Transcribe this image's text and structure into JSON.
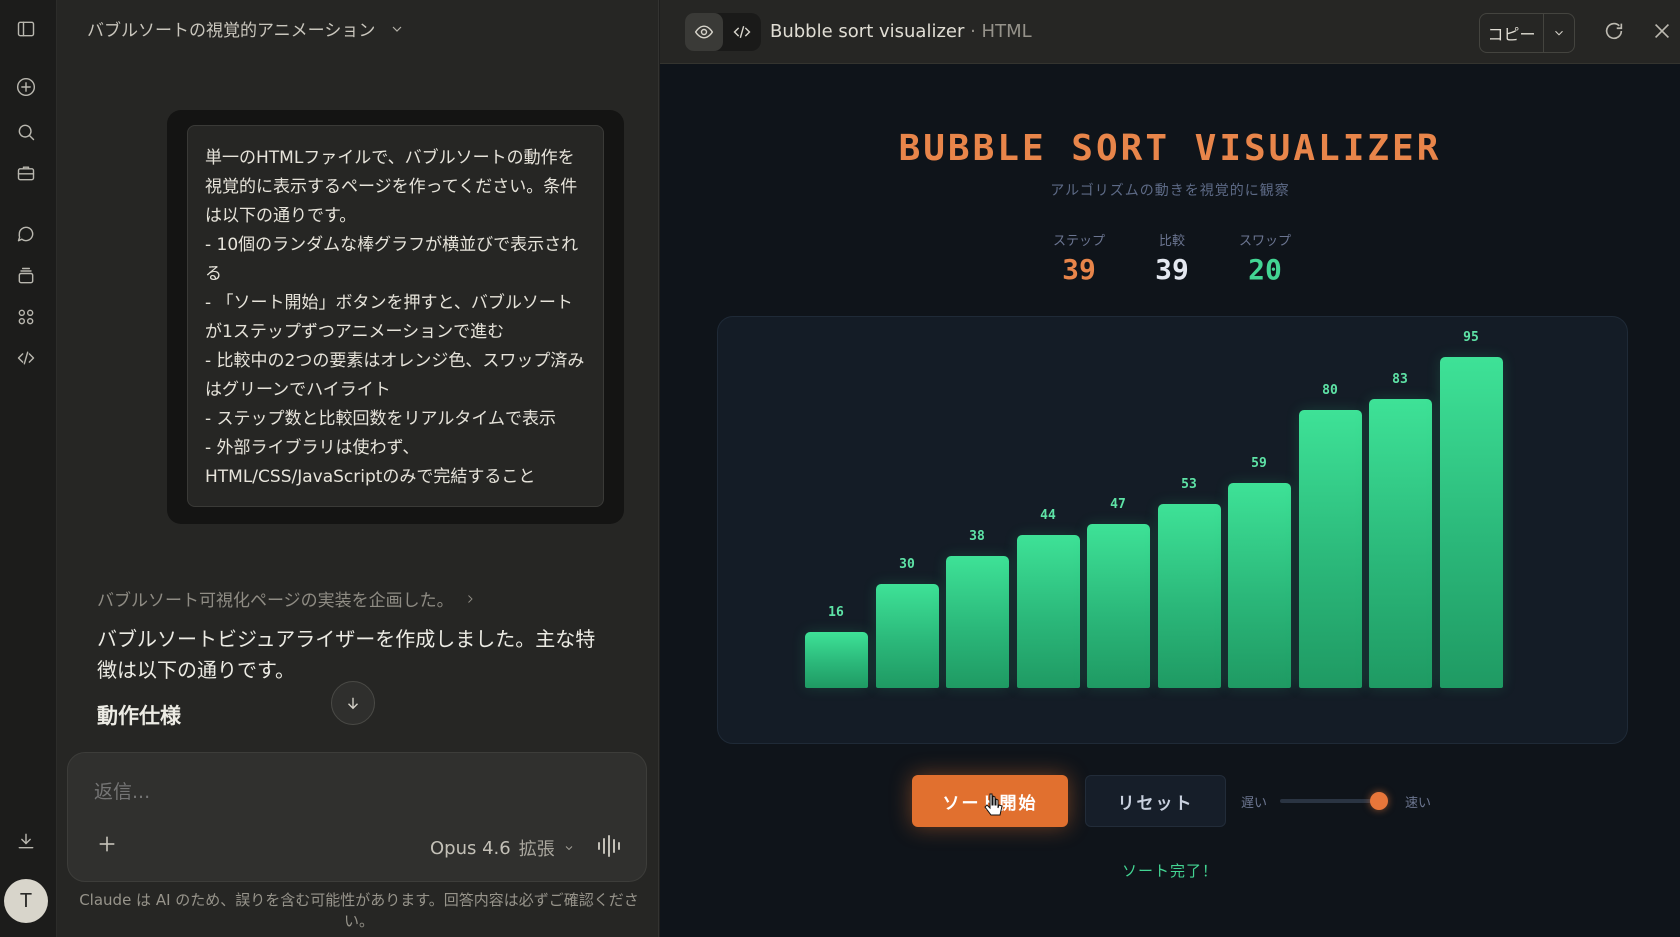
{
  "sidebar": {
    "icons": [
      "sidebar-toggle-icon",
      "new-chat-icon",
      "search-icon",
      "projects-icon",
      "chats-icon",
      "artifacts-stack-icon",
      "apps-icon",
      "code-icon",
      "download-icon"
    ],
    "avatar_initial": "T"
  },
  "chat": {
    "title": "バブルソートの視覚的アニメーション",
    "user_message": "単一のHTMLファイルで、バブルソートの動作を視覚的に表示するページを作ってください。条件は以下の通りです。\n- 10個のランダムな棒グラフが横並びで表示される\n- 「ソート開始」ボタンを押すと、バブルソートが1ステップずつアニメーションで進む\n- 比較中の2つの要素はオレンジ色、スワップ済みはグリーンでハイライト\n- ステップ数と比較回数をリアルタイムで表示\n- 外部ライブラリは使わず、HTML/CSS/JavaScriptのみで完結すること",
    "thinking_summary": "バブルソート可視化ページの実装を企画した。",
    "assistant_reply": "バブルソートビジュアライザーを作成しました。主な特徴は以下の通りです。",
    "section_heading": "動作仕様",
    "composer_placeholder": "返信...",
    "model_name": "Opus 4.6",
    "model_mode": "拡張",
    "disclaimer": "Claude は AI のため、誤りを含む可能性があります。回答内容は必ずご確認ください。"
  },
  "artifact": {
    "title": "Bubble sort visualizer",
    "type_suffix": "· HTML",
    "copy_label": "コピー",
    "viz": {
      "heading": "BUBBLE SORT VISUALIZER",
      "subheading": "アルゴリズムの動きを視覚的に観察",
      "stats": [
        {
          "label": "ステップ",
          "value": "39",
          "color": "#e8854a"
        },
        {
          "label": "比較",
          "value": "39",
          "color": "#e4e8f0"
        },
        {
          "label": "スワップ",
          "value": "20",
          "color": "#43d593"
        }
      ],
      "start_label": "ソート開始",
      "reset_label": "リセット",
      "speed_slow": "遅い",
      "speed_fast": "速い",
      "speed_level": 0.95,
      "status": "ソート完了！"
    }
  },
  "chart_data": {
    "type": "bar",
    "values": [
      16,
      30,
      38,
      44,
      47,
      53,
      59,
      80,
      83,
      95
    ],
    "ylim": [
      0,
      100
    ],
    "bar_color": "#34d08c"
  }
}
